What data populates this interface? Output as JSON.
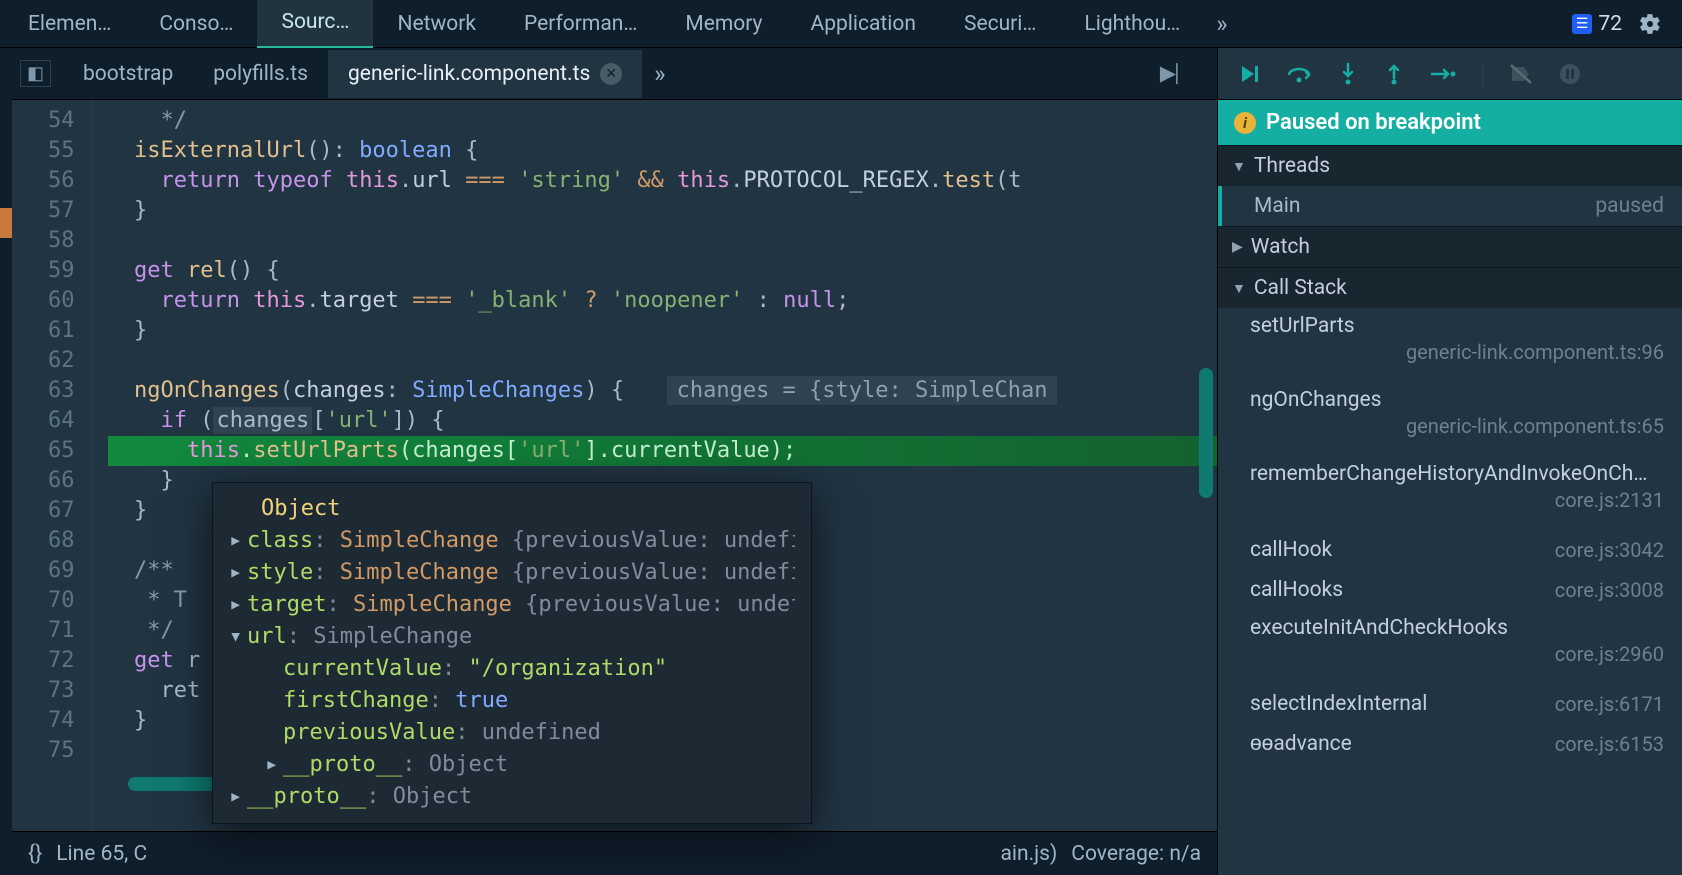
{
  "topTabs": {
    "items": [
      "Elemen…",
      "Conso…",
      "Sourc…",
      "Network",
      "Performan…",
      "Memory",
      "Application",
      "Securi…",
      "Lighthou…"
    ],
    "activeIndex": 2,
    "errorCount": "72"
  },
  "fileTabs": {
    "items": [
      "bootstrap",
      "polyfills.ts",
      "generic-link.component.ts"
    ],
    "activeIndex": 2
  },
  "code": {
    "startLine": 54,
    "lines": [
      {
        "n": 54,
        "html": "    */",
        "cls": "tk-comment"
      },
      {
        "n": 55,
        "html": "  <span class='tk-fn'>isExternalUrl</span>(): <span class='tk-type'>boolean</span> {"
      },
      {
        "n": 56,
        "html": "    <span class='tk-keyword'>return</span> <span class='tk-keyword'>typeof</span> <span class='tk-this'>this</span>.<span class='tk-prop'>url</span> <span class='tk-op'>===</span> <span class='tk-string'>'string'</span> <span class='tk-op'>&&</span> <span class='tk-this'>this</span>.<span class='tk-prop'>PROTOCOL_REGEX</span>.<span class='tk-fn'>test</span>(t"
      },
      {
        "n": 57,
        "html": "  }"
      },
      {
        "n": 58,
        "html": ""
      },
      {
        "n": 59,
        "html": "  <span class='tk-keyword'>get</span> <span class='tk-fn'>rel</span>() {"
      },
      {
        "n": 60,
        "html": "    <span class='tk-keyword'>return</span> <span class='tk-this'>this</span>.<span class='tk-prop'>target</span> <span class='tk-op'>===</span> <span class='tk-string'>'_blank'</span> <span class='tk-op'>?</span> <span class='tk-string'>'noopener'</span> : <span class='tk-keyword'>null</span>;"
      },
      {
        "n": 61,
        "html": "  }"
      },
      {
        "n": 62,
        "html": ""
      },
      {
        "n": 63,
        "html": "  <span class='tk-fn'>ngOnChanges</span>(<span class='tk-prop'>changes</span>: <span class='tk-type'>SimpleChanges</span>) {  <span class='inline-hint'>changes = {style: SimpleChan</span>"
      },
      {
        "n": 64,
        "html": "    <span class='tk-keyword'>if</span> (<span style='background:rgba(255,255,255,.08);padding:1px 3px;'>changes</span>[<span class='tk-string'>'url'</span>]) {"
      },
      {
        "n": 65,
        "html": "      <span class='tk-this'>this</span>.<span class='tk-fn'>setUrlParts</span>(changes[<span class='tk-string'>'url'</span>].currentValue);",
        "highlight": true
      },
      {
        "n": 66,
        "html": "    }"
      },
      {
        "n": 67,
        "html": "  }"
      },
      {
        "n": 68,
        "html": ""
      },
      {
        "n": 69,
        "html": "  /**",
        "cls": "tk-comment"
      },
      {
        "n": 70,
        "html": "   * T",
        "cls": "tk-comment"
      },
      {
        "n": 71,
        "html": "   */",
        "cls": "tk-comment"
      },
      {
        "n": 72,
        "html": "  <span class='tk-keyword'>get</span> r"
      },
      {
        "n": 73,
        "html": "    ret"
      },
      {
        "n": 74,
        "html": "  }"
      },
      {
        "n": 75,
        "html": ""
      }
    ]
  },
  "tooltip": {
    "header": "Object",
    "rows": [
      {
        "arrow": "▸",
        "name": "class",
        "sep": ":",
        "type": "SimpleChange",
        "rest": " {previousValue: undefi"
      },
      {
        "arrow": "▸",
        "name": "style",
        "sep": ":",
        "type": "SimpleChange",
        "rest": " {previousValue: undefi"
      },
      {
        "arrow": "▸",
        "name": "target",
        "sep": ":",
        "type": "SimpleChange",
        "rest": " {previousValue: undef"
      },
      {
        "arrow": "▾",
        "name": "url",
        "sep": ":",
        "dimtype": "SimpleChange"
      }
    ],
    "urlExpanded": [
      {
        "name": "currentValue",
        "val": "\"/organization\"",
        "valcls": "pval"
      },
      {
        "name": "firstChange",
        "val": "true",
        "valcls": "blue"
      },
      {
        "name": "previousValue",
        "val": "undefined",
        "valcls": "undef"
      },
      {
        "arrow": "▸",
        "name": "__proto__",
        "dimval": "Object"
      }
    ],
    "proto": {
      "arrow": "▸",
      "name": "__proto__",
      "dimval": "Object"
    }
  },
  "statusBar": {
    "bracket": "{}",
    "position": "Line 65, C",
    "mapped": "ain.js)",
    "coverage": "Coverage: n/a"
  },
  "debug": {
    "paused": "Paused on breakpoint",
    "sections": {
      "threads": "Threads",
      "watch": "Watch",
      "callstack": "Call Stack"
    },
    "thread": {
      "name": "Main",
      "status": "paused"
    },
    "callstack": [
      {
        "fn": "setUrlParts",
        "loc": "generic-link.component.ts:96"
      },
      {
        "fn": "ngOnChanges",
        "loc": "generic-link.component.ts:65"
      },
      {
        "fn": "rememberChangeHistoryAndInvokeOnCh…",
        "loc": "core.js:2131"
      },
      {
        "fn": "callHook",
        "loc": "core.js:3042",
        "single": true
      },
      {
        "fn": "callHooks",
        "loc": "core.js:3008",
        "single": true
      },
      {
        "fn": "executeInitAndCheckHooks",
        "loc": "core.js:2960"
      },
      {
        "fn": "selectIndexInternal",
        "loc": "core.js:6171",
        "single": true
      },
      {
        "fn": "ɵɵadvance",
        "loc": "core.js:6153",
        "single": true
      }
    ]
  }
}
